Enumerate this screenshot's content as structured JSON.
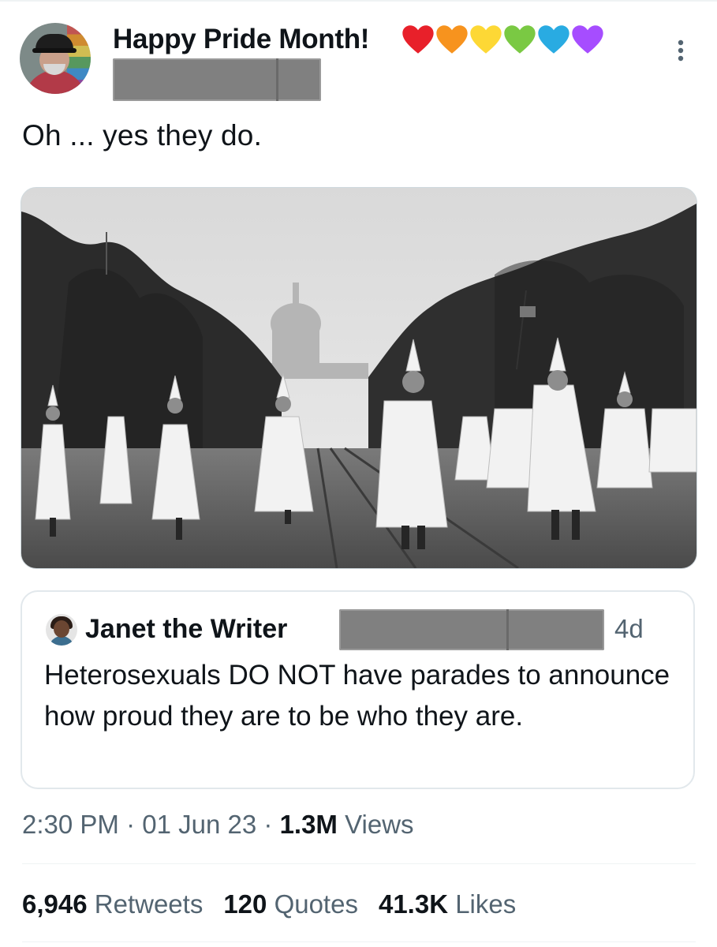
{
  "author": {
    "display_name": "Happy Pride Month!",
    "name_emoji": [
      "red-heart",
      "orange-heart",
      "yellow-heart",
      "green-heart",
      "blue-heart",
      "purple-heart"
    ],
    "heart_colors": [
      "#e8202a",
      "#f7931e",
      "#fdd835",
      "#7ac943",
      "#29abe2",
      "#a64dff"
    ]
  },
  "tweet": {
    "text": "Oh ... yes they do."
  },
  "quoted": {
    "name": "Janet the Writer",
    "time": "4d",
    "text": "Heterosexuals DO NOT have parades to announce how proud they are to be who they are."
  },
  "meta": {
    "time": "2:30 PM",
    "sep1": "·",
    "date": "01 Jun 23",
    "sep2": "·",
    "views_count": "1.3M",
    "views_label": "Views"
  },
  "stats": {
    "retweets_count": "6,946",
    "retweets_label": "Retweets",
    "quotes_count": "120",
    "quotes_label": "Quotes",
    "likes_count": "41.3K",
    "likes_label": "Likes"
  },
  "colors": {
    "text_primary": "#0f1419",
    "text_secondary": "#536471",
    "border": "#e2e8ec",
    "redaction": "#808080"
  }
}
